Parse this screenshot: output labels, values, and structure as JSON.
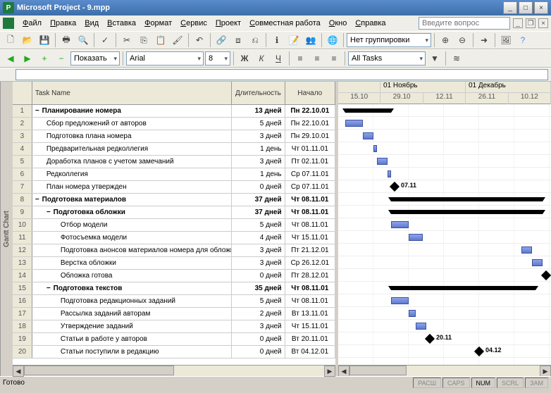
{
  "window": {
    "title": "Microsoft Project - 9.mpp"
  },
  "menu": {
    "items": [
      "Файл",
      "Правка",
      "Вид",
      "Вставка",
      "Формат",
      "Сервис",
      "Проект",
      "Совместная работа",
      "Окно",
      "Справка"
    ],
    "search_placeholder": "Введите вопрос"
  },
  "toolbar2": {
    "show_label": "Показать",
    "font": "Arial",
    "font_size": "8",
    "filter": "All Tasks"
  },
  "grouping": "Нет группировки",
  "sidebar_label": "Gantt Chart",
  "columns": {
    "name": "Task Name",
    "duration": "Длительность",
    "start": "Начало"
  },
  "timeline": {
    "months": [
      "01 Ноябрь",
      "01 Декабрь"
    ],
    "ticks": [
      "15.10",
      "29.10",
      "12.11",
      "26.11",
      "10.12"
    ]
  },
  "tasks": [
    {
      "n": 1,
      "name": "Планирование номера",
      "dur": "13 дней",
      "start": "Пн 22.10.01",
      "lvl": 0,
      "sum": true,
      "bar": [
        10,
        75
      ]
    },
    {
      "n": 2,
      "name": "Сбор предложений от авторов",
      "dur": "5 дней",
      "start": "Пн 22.10.01",
      "lvl": 1,
      "bar": [
        10,
        35
      ]
    },
    {
      "n": 3,
      "name": "Подготовка плана номера",
      "dur": "3 дней",
      "start": "Пн 29.10.01",
      "lvl": 1,
      "bar": [
        35,
        50
      ]
    },
    {
      "n": 4,
      "name": "Предварительная редколлегия",
      "dur": "1 день",
      "start": "Чт 01.11.01",
      "lvl": 1,
      "bar": [
        50,
        55
      ]
    },
    {
      "n": 5,
      "name": "Доработка планов с учетом замечаний",
      "dur": "3 дней",
      "start": "Пт 02.11.01",
      "lvl": 1,
      "bar": [
        55,
        70
      ]
    },
    {
      "n": 6,
      "name": "Редколлегия",
      "dur": "1 день",
      "start": "Ср 07.11.01",
      "lvl": 1,
      "bar": [
        70,
        75
      ]
    },
    {
      "n": 7,
      "name": "План номера утвержден",
      "dur": "0 дней",
      "start": "Ср 07.11.01",
      "lvl": 1,
      "mile": 75,
      "mlabel": "07.11"
    },
    {
      "n": 8,
      "name": "Подготовка материалов",
      "dur": "37 дней",
      "start": "Чт 08.11.01",
      "lvl": 0,
      "sum": true,
      "bar": [
        75,
        290
      ]
    },
    {
      "n": 9,
      "name": "Подготовка обложки",
      "dur": "37 дней",
      "start": "Чт 08.11.01",
      "lvl": 1,
      "sum": true,
      "bar": [
        75,
        290
      ]
    },
    {
      "n": 10,
      "name": "Отбор модели",
      "dur": "5 дней",
      "start": "Чт 08.11.01",
      "lvl": 2,
      "bar": [
        75,
        100
      ]
    },
    {
      "n": 11,
      "name": "Фотосъемка модели",
      "dur": "4 дней",
      "start": "Чт 15.11.01",
      "lvl": 2,
      "bar": [
        100,
        120
      ]
    },
    {
      "n": 12,
      "name": "Подготовка анонсов материалов номера для обложки",
      "dur": "3 дней",
      "start": "Пт 21.12.01",
      "lvl": 2,
      "bar": [
        260,
        275
      ]
    },
    {
      "n": 13,
      "name": "Верстка обложки",
      "dur": "3 дней",
      "start": "Ср 26.12.01",
      "lvl": 2,
      "bar": [
        275,
        290
      ]
    },
    {
      "n": 14,
      "name": "Обложка готова",
      "dur": "0 дней",
      "start": "Пт 28.12.01",
      "lvl": 2,
      "mile": 290
    },
    {
      "n": 15,
      "name": "Подготовка текстов",
      "dur": "35 дней",
      "start": "Чт 08.11.01",
      "lvl": 1,
      "sum": true,
      "bar": [
        75,
        280
      ]
    },
    {
      "n": 16,
      "name": "Подготовка редакционных заданий",
      "dur": "5 дней",
      "start": "Чт 08.11.01",
      "lvl": 2,
      "bar": [
        75,
        100
      ]
    },
    {
      "n": 17,
      "name": "Рассылка заданий авторам",
      "dur": "2 дней",
      "start": "Вт 13.11.01",
      "lvl": 2,
      "bar": [
        100,
        110
      ]
    },
    {
      "n": 18,
      "name": "Утверждение заданий",
      "dur": "3 дней",
      "start": "Чт 15.11.01",
      "lvl": 2,
      "bar": [
        110,
        125
      ]
    },
    {
      "n": 19,
      "name": "Статьи в работе у авторов",
      "dur": "0 дней",
      "start": "Вт 20.11.01",
      "lvl": 2,
      "mile": 125,
      "mlabel": "20.11"
    },
    {
      "n": 20,
      "name": "Статьи поступили в редакцию",
      "dur": "0 дней",
      "start": "Вт 04.12.01",
      "lvl": 2,
      "mile": 195,
      "mlabel": "04.12"
    }
  ],
  "status": {
    "ready": "Готово",
    "cells": [
      "РАСШ",
      "CAPS",
      "NUM",
      "SCRL",
      "ЗАМ"
    ],
    "active_idx": 2
  }
}
